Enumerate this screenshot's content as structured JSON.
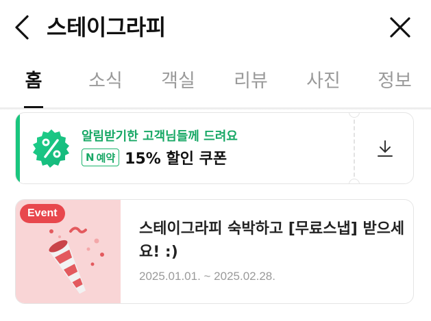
{
  "header": {
    "title": "스테이그라피",
    "back_icon": "chevron-left-icon",
    "close_icon": "close-icon"
  },
  "tabs": [
    {
      "label": "홈",
      "active": true
    },
    {
      "label": "소식",
      "active": false
    },
    {
      "label": "객실",
      "active": false
    },
    {
      "label": "리뷰",
      "active": false
    },
    {
      "label": "사진",
      "active": false
    },
    {
      "label": "정보",
      "active": false
    }
  ],
  "coupon": {
    "caption": "알림받기한 고객님들께 드려요",
    "badge_n": "N",
    "badge_label": "예약",
    "title": "15% 할인 쿠폰",
    "icon": "percent-badge-icon",
    "action_icon": "download-icon",
    "accent_color": "#19c67e"
  },
  "event": {
    "badge": "Event",
    "title": "스테이그라피 숙박하고 [무료스냅] 받으세요! :)",
    "date": "2025.01.01. ~ 2025.02.28.",
    "thumb_color": "#f9d5d6",
    "badge_color": "#e8474d"
  }
}
